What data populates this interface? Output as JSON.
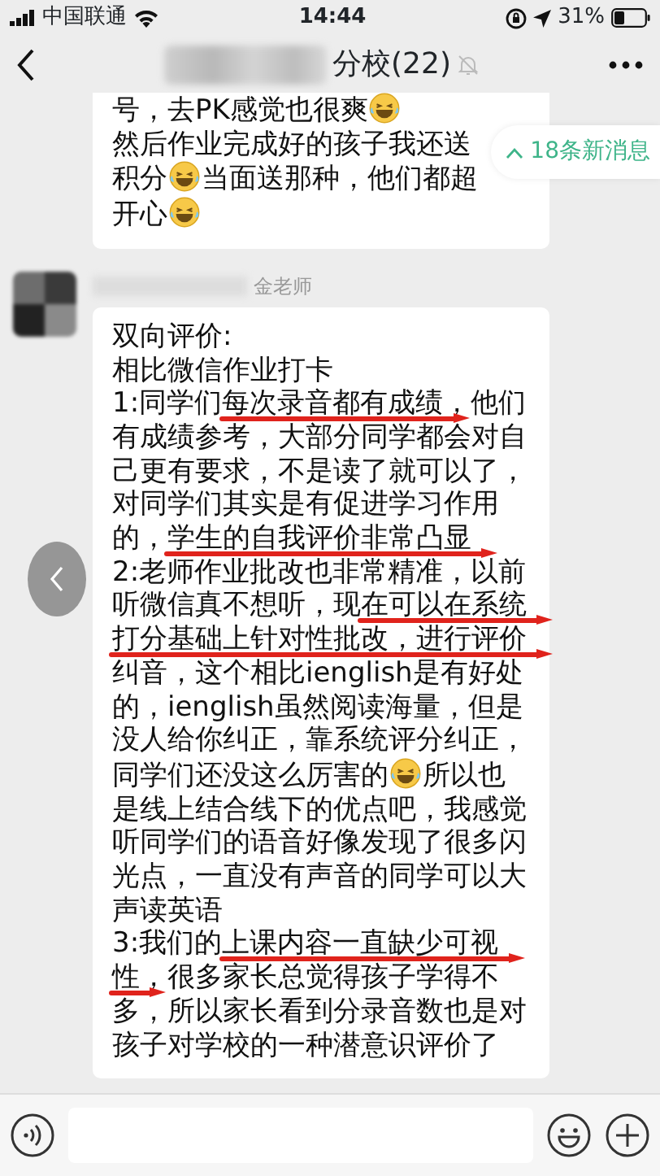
{
  "status_bar": {
    "carrier": "中国联通",
    "time": "14:44",
    "battery": "31%"
  },
  "header": {
    "title": "分校(22)",
    "muted": true
  },
  "new_messages": {
    "label": "18条新消息"
  },
  "messages": [
    {
      "lines": [
        [
          {
            "kind": "text",
            "text": "号，去PK感觉也很爽",
            "underlined": false
          },
          {
            "kind": "emoji"
          }
        ],
        [
          {
            "kind": "text",
            "text": "然后作业完成好的孩子我还送",
            "underlined": false
          }
        ],
        [
          {
            "kind": "text",
            "text": "积分",
            "underlined": false
          },
          {
            "kind": "emoji"
          },
          {
            "kind": "text",
            "text": "当面送那种，他们都超",
            "underlined": false
          }
        ],
        [
          {
            "kind": "text",
            "text": "开心",
            "underlined": false
          },
          {
            "kind": "emoji"
          }
        ]
      ]
    },
    {
      "sender": "金老师",
      "lines": [
        [
          {
            "kind": "text",
            "text": "双向评价:",
            "underlined": false
          }
        ],
        [
          {
            "kind": "text",
            "text": "相比微信作业打卡",
            "underlined": false
          }
        ],
        [
          {
            "kind": "text",
            "text": "1:同学们",
            "underlined": false
          },
          {
            "kind": "text",
            "text": "每次录音都有成绩",
            "underlined": true
          },
          {
            "kind": "text",
            "text": "，他们",
            "underlined": false
          }
        ],
        [
          {
            "kind": "text",
            "text": "有成绩参考，大部分同学都会对自",
            "underlined": false
          }
        ],
        [
          {
            "kind": "text",
            "text": "己更有要求，不是读了就可以了，",
            "underlined": false
          }
        ],
        [
          {
            "kind": "text",
            "text": "对同学们其实是有促进学习作用",
            "underlined": false
          }
        ],
        [
          {
            "kind": "text",
            "text": "的，",
            "underlined": false
          },
          {
            "kind": "text",
            "text": "学生的自我评价非常凸显",
            "underlined": true
          }
        ],
        [
          {
            "kind": "text",
            "text": "2:老师作业批改也非常精准，以前",
            "underlined": false
          }
        ],
        [
          {
            "kind": "text",
            "text": "听微信真不想听，现",
            "underlined": false
          },
          {
            "kind": "text",
            "text": "在可以在系统",
            "underlined": true
          }
        ],
        [
          {
            "kind": "text",
            "text": "打分基础上针对性批改，进行评价",
            "underlined": true
          }
        ],
        [
          {
            "kind": "text",
            "text": "纠音，这个相比ienglish是有好处",
            "underlined": false
          }
        ],
        [
          {
            "kind": "text",
            "text": "的，ienglish虽然阅读海量，但是",
            "underlined": false
          }
        ],
        [
          {
            "kind": "text",
            "text": "没人给你纠正，靠系统评分纠正，",
            "underlined": false
          }
        ],
        [
          {
            "kind": "text",
            "text": "同学们还没这么厉害的",
            "underlined": false
          },
          {
            "kind": "emoji"
          },
          {
            "kind": "text",
            "text": "所以也",
            "underlined": false
          }
        ],
        [
          {
            "kind": "text",
            "text": "是线上结合线下的优点吧，我感觉",
            "underlined": false
          }
        ],
        [
          {
            "kind": "text",
            "text": "听同学们的语音好像发现了很多闪",
            "underlined": false
          }
        ],
        [
          {
            "kind": "text",
            "text": "光点，一直没有声音的同学可以大",
            "underlined": false
          }
        ],
        [
          {
            "kind": "text",
            "text": "声读英语",
            "underlined": false
          }
        ],
        [
          {
            "kind": "text",
            "text": "3:我们的",
            "underlined": false
          },
          {
            "kind": "text",
            "text": "上课内容一直缺少可视",
            "underlined": true
          }
        ],
        [
          {
            "kind": "text",
            "text": "性",
            "underlined": true
          },
          {
            "kind": "text",
            "text": "，很多家长总觉得孩子学得不",
            "underlined": false
          }
        ],
        [
          {
            "kind": "text",
            "text": "多，所以家长看到分录音数也是对",
            "underlined": false
          }
        ],
        [
          {
            "kind": "text",
            "text": "孩子对学校的一种潜意识评价了",
            "underlined": false
          }
        ]
      ]
    }
  ]
}
